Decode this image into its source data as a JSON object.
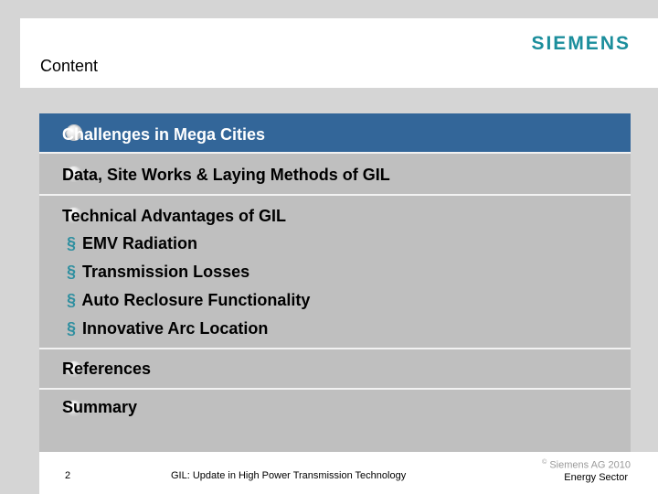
{
  "header": {
    "title": "Content",
    "logo_text": "SIEMENS"
  },
  "menu": {
    "items": [
      {
        "label": "Challenges in Mega Cities"
      },
      {
        "label": "Data, Site Works & Laying Methods of GIL"
      },
      {
        "label": "Technical Advantages of GIL"
      },
      {
        "label": "References"
      },
      {
        "label": "Summary"
      }
    ],
    "subitems": [
      {
        "marker": "§",
        "label": "EMV Radiation"
      },
      {
        "marker": "§",
        "label": "Transmission Losses"
      },
      {
        "marker": "§",
        "label": "Auto Reclosure Functionality"
      },
      {
        "marker": "§",
        "label": "Innovative Arc Location"
      }
    ]
  },
  "footer": {
    "page_number": "2",
    "presentation_title": "GIL: Update in High Power Transmission Technology",
    "copyright_symbol": "©",
    "copyright": "Siemens AG 2010",
    "sector": "Energy Sector"
  },
  "colors": {
    "accent": "#336699",
    "logo": "#1b8e9c",
    "panel": "#bfbfbf"
  }
}
